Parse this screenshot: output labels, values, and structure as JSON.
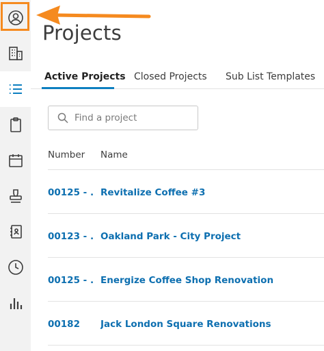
{
  "page": {
    "title": "Projects"
  },
  "nav": {
    "items": [
      {
        "name": "account-icon"
      },
      {
        "name": "company-icon"
      },
      {
        "name": "projects-list-icon"
      },
      {
        "name": "clipboard-icon"
      },
      {
        "name": "calendar-icon"
      },
      {
        "name": "stamp-icon"
      },
      {
        "name": "directory-icon"
      },
      {
        "name": "clock-icon"
      },
      {
        "name": "reports-icon"
      }
    ]
  },
  "tabs": [
    {
      "label": "Active Projects"
    },
    {
      "label": "Closed Projects"
    },
    {
      "label": "Sub List Templates"
    }
  ],
  "search": {
    "placeholder": "Find a project",
    "value": ""
  },
  "table": {
    "headers": {
      "number": "Number",
      "name": "Name"
    },
    "rows": [
      {
        "number": "00125 - ...",
        "name": "Revitalize Coffee #3"
      },
      {
        "number": "00123 - ...",
        "name": "Oakland Park - City Project"
      },
      {
        "number": "00125 - ...",
        "name": "Energize Coffee Shop Renovation"
      },
      {
        "number": "00182",
        "name": "Jack London Square Renovations"
      }
    ]
  },
  "colors": {
    "accent": "#0d7fc0",
    "link": "#0d6fb0",
    "highlight": "#f58a1f",
    "rail": "#f2f2f2"
  }
}
